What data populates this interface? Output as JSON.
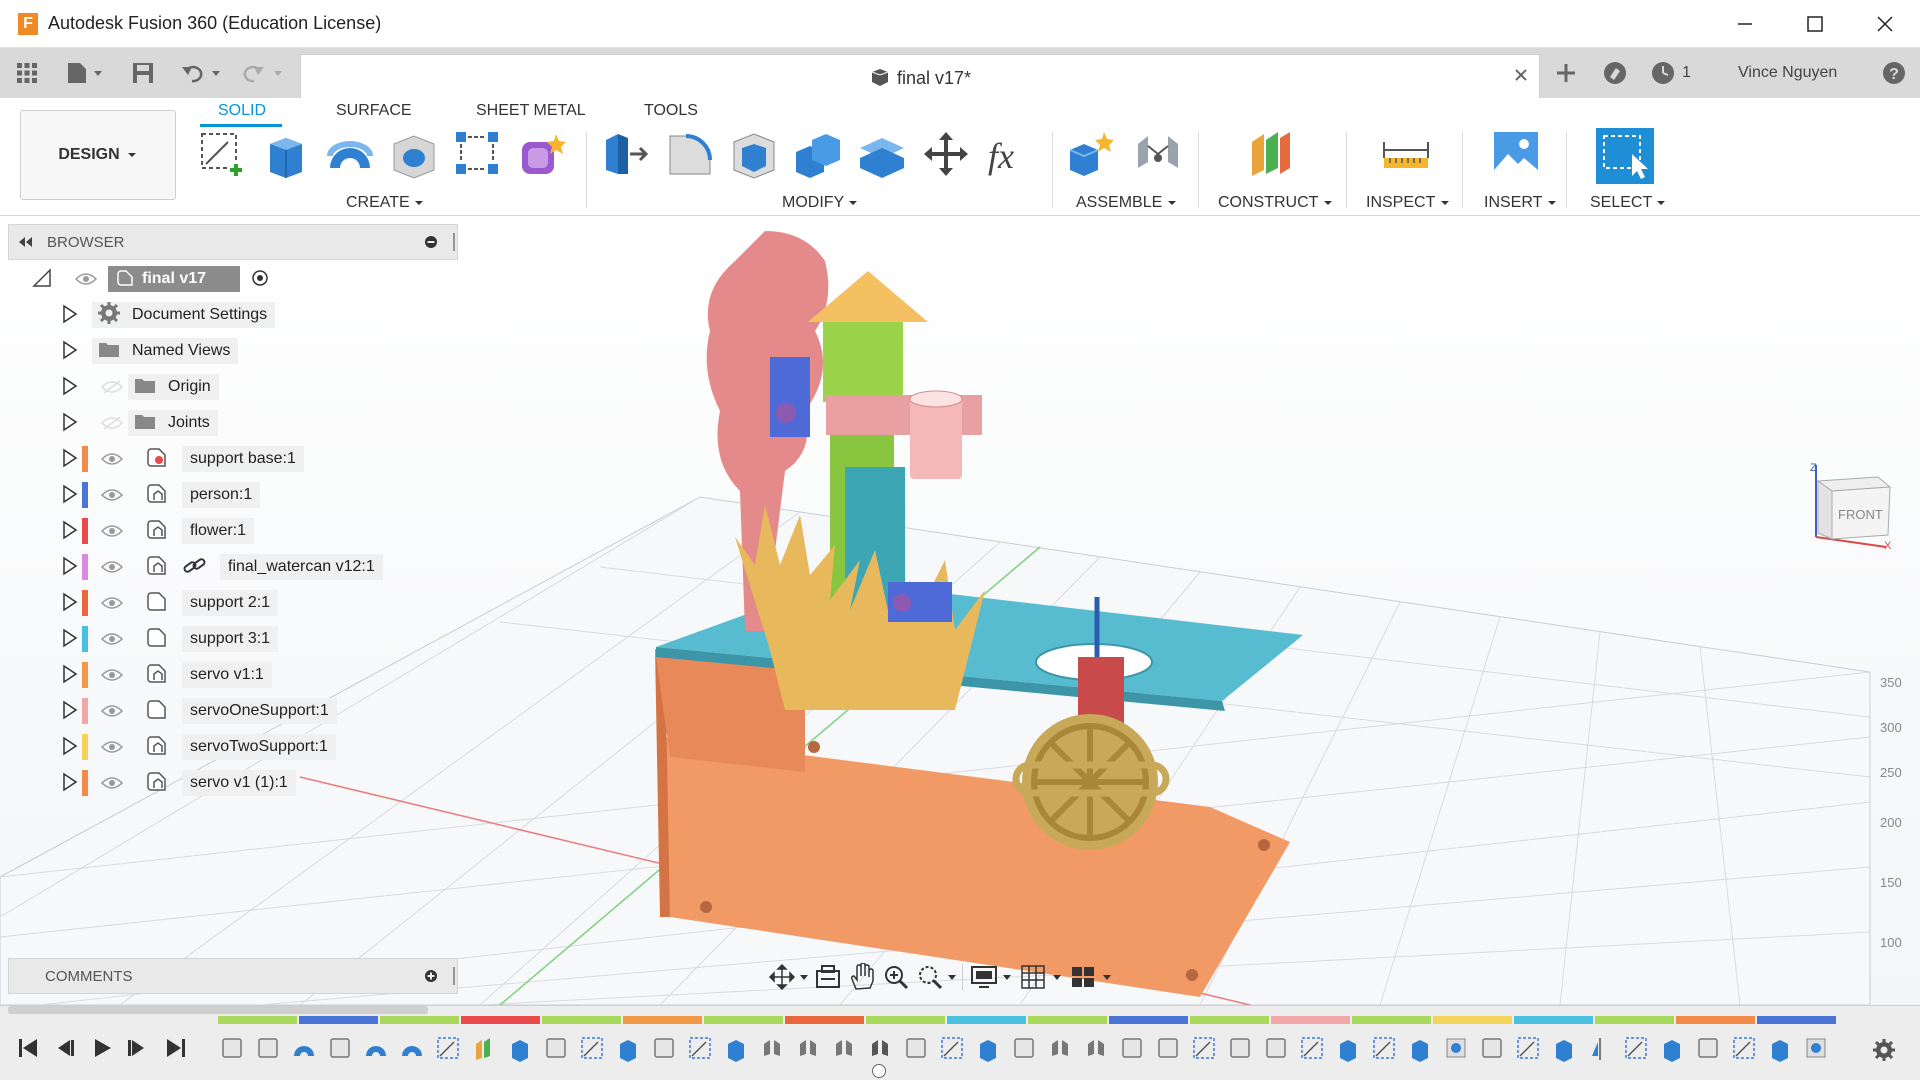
{
  "window": {
    "title": "Autodesk Fusion 360 (Education License)"
  },
  "topbar": {
    "document_tab": "final v17*",
    "job_count": "1",
    "user_name": "Vince Nguyen"
  },
  "ribbon": {
    "workspace": "DESIGN",
    "tabs": [
      "SOLID",
      "SURFACE",
      "SHEET METAL",
      "TOOLS"
    ],
    "active_tab": "SOLID",
    "groups": [
      "CREATE",
      "MODIFY",
      "ASSEMBLE",
      "CONSTRUCT",
      "INSPECT",
      "INSERT",
      "SELECT"
    ]
  },
  "browser": {
    "title": "BROWSER",
    "root": "final v17",
    "items": [
      {
        "label": "Document Settings",
        "icon": "gear-icon"
      },
      {
        "label": "Named Views",
        "icon": "folder-icon"
      },
      {
        "label": "Origin",
        "icon": "folder-icon"
      },
      {
        "label": "Joints",
        "icon": "folder-icon"
      }
    ],
    "components": [
      {
        "label": "support base:1",
        "color": "#f28a4a",
        "icon": "grounded-component-icon",
        "linked": false
      },
      {
        "label": "person:1",
        "color": "#4a74d6",
        "icon": "component-icon",
        "linked": false
      },
      {
        "label": "flower:1",
        "color": "#e94a4a",
        "icon": "component-icon",
        "linked": false
      },
      {
        "label": "final_watercan v12:1",
        "color": "#d98ae0",
        "icon": "component-icon",
        "linked": true
      },
      {
        "label": "support 2:1",
        "color": "#e8673c",
        "icon": "body-icon",
        "linked": false
      },
      {
        "label": "support 3:1",
        "color": "#4ac0e0",
        "icon": "body-icon",
        "linked": false
      },
      {
        "label": "servo v1:1",
        "color": "#f2994a",
        "icon": "component-icon",
        "linked": false
      },
      {
        "label": "servoOneSupport:1",
        "color": "#f2a8a8",
        "icon": "body-icon",
        "linked": false
      },
      {
        "label": "servoTwoSupport:1",
        "color": "#f5d35a",
        "icon": "component-icon",
        "linked": false
      },
      {
        "label": "servo v1 (1):1",
        "color": "#f28a4a",
        "icon": "component-icon",
        "linked": false
      }
    ]
  },
  "viewcube": {
    "face": "FRONT"
  },
  "comments": {
    "title": "COMMENTS"
  },
  "timeline": {
    "color_segments": [
      "#a8d85c",
      "#4a74d6",
      "#a8d85c",
      "#e94a4a",
      "#a8d85c",
      "#f2994a",
      "#a8d85c",
      "#e8673c",
      "#a8d85c",
      "#4ac0e0",
      "#a8d85c",
      "#4a74d6",
      "#a8d85c",
      "#f2a8a8",
      "#a8d85c",
      "#f5d35a",
      "#4ac0e0",
      "#a8d85c",
      "#f28a4a",
      "#4a74d6"
    ],
    "feature_icons": [
      "body",
      "body",
      "revolve",
      "body",
      "revolve",
      "revolve",
      "sketch",
      "construct",
      "extrude",
      "body",
      "sketch",
      "extrude",
      "body",
      "sketch",
      "extrude",
      "joint",
      "joint",
      "joint",
      "joint-group",
      "body",
      "sketch",
      "extrude",
      "sketch-plane",
      "joint",
      "joint",
      "body",
      "body",
      "sketch",
      "body",
      "body",
      "sketch",
      "extrude",
      "sketch",
      "extrude",
      "hole",
      "fillet",
      "sketch",
      "extrude",
      "mirror",
      "sketch",
      "extrude",
      "fillet",
      "sketch",
      "extrude",
      "hole"
    ]
  }
}
